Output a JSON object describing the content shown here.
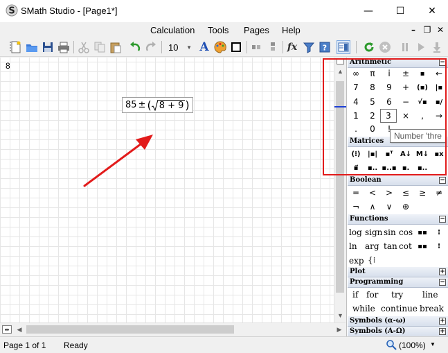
{
  "window": {
    "title": "SMath Studio - [Page1*]",
    "minimize": "—",
    "maximize": "☐",
    "close": "✕"
  },
  "menu": {
    "items": [
      "Calculation",
      "Tools",
      "Pages",
      "Help"
    ],
    "mdi_minimize": "–",
    "mdi_restore": "❐",
    "mdi_close": "✕"
  },
  "toolbar": {
    "font_size": "10",
    "fx_label": "fx",
    "text_label": "A"
  },
  "worksheet": {
    "line_number": "8",
    "expression": {
      "left": "85",
      "operator": "±",
      "radicand": "8 + 9"
    }
  },
  "panels": {
    "arithmetic": {
      "title": "Arithmetic",
      "toggle": "−",
      "rows": [
        [
          "∞",
          "π",
          "i",
          "±",
          "▪",
          "←"
        ],
        [
          "7",
          "8",
          "9",
          "+",
          "(▪)",
          "|▪"
        ],
        [
          "4",
          "5",
          "6",
          "−",
          "√▪",
          "▪/"
        ],
        [
          "1",
          "2",
          "3",
          "×",
          ",",
          "→"
        ],
        [
          ".",
          "0",
          "!",
          "",
          "",
          ""
        ]
      ],
      "selected": "3"
    },
    "matrices": {
      "title": "Matrices",
      "toggle": "−",
      "rows": [
        [
          "(⁝)",
          "|▪|",
          "▪ᵀ",
          "A↓",
          "M↓",
          "▪x"
        ],
        [
          "▪⃗",
          "▪..",
          "▪..▪",
          "▪.",
          "▪.."
        ]
      ]
    },
    "boolean": {
      "title": "Boolean",
      "toggle": "−",
      "rows": [
        [
          "=",
          "<",
          ">",
          "≤",
          "≥",
          "≠"
        ],
        [
          "¬",
          "∧",
          "∨",
          "⊕"
        ]
      ]
    },
    "functions": {
      "title": "Functions",
      "toggle": "−",
      "rows": [
        [
          "log",
          "sign",
          "sin",
          "cos"
        ],
        [
          "ln",
          "arg",
          "tan",
          "cot"
        ],
        [
          "exp",
          "{⁝"
        ]
      ]
    },
    "plot": {
      "title": "Plot",
      "toggle": "+"
    },
    "programming": {
      "title": "Programming",
      "toggle": "−",
      "rows": [
        [
          "if",
          "for",
          "try",
          "line"
        ],
        [
          "while",
          "continue",
          "break"
        ]
      ]
    },
    "symbols_latin": {
      "title": "Symbols (α-ω)",
      "toggle": "+"
    },
    "symbols_greek": {
      "title": "Symbols (Α-Ω)",
      "toggle": "+"
    }
  },
  "tooltip": "Number 'thre",
  "status": {
    "page": "Page 1 of 1",
    "state": "Ready",
    "zoom": "(100%)"
  },
  "colors": {
    "annotation_red": "#e21b1b",
    "grid": "#e6e6e6",
    "panel_header": "#d7dfec"
  }
}
